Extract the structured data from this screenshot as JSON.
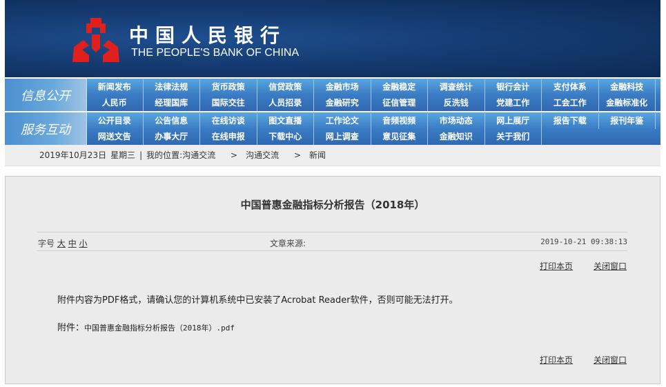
{
  "header": {
    "title_cn": "中国人民银行",
    "title_en": "THE PEOPLE'S BANK OF CHINA"
  },
  "nav": [
    {
      "label": "信息公开",
      "rows": [
        [
          "新闻发布",
          "法律法规",
          "货币政策",
          "信贷政策",
          "金融市场",
          "金融稳定",
          "调查统计",
          "银行会计",
          "支付体系",
          "金融科技"
        ],
        [
          "人民币",
          "经理国库",
          "国际交往",
          "人员招录",
          "金融研究",
          "征信管理",
          "反洗钱",
          "党建工作",
          "工会工作",
          "金融标准化"
        ]
      ]
    },
    {
      "label": "服务互动",
      "rows": [
        [
          "公开目录",
          "公告信息",
          "在线访谈",
          "图文直播",
          "工作论文",
          "音频视频",
          "市场动态",
          "网上展厅",
          "报告下载",
          "报刊年鉴"
        ],
        [
          "网送文告",
          "办事大厅",
          "在线申报",
          "下载中心",
          "网上调查",
          "意见征集",
          "金融知识",
          "关于我们"
        ]
      ]
    }
  ],
  "breadcrumb": {
    "date": "2019年10月23日",
    "weekday": "星期三",
    "sep": "|",
    "location_label": "我的位置:",
    "items": [
      "沟通交流",
      "沟通交流",
      "新闻"
    ],
    "arrow": ">"
  },
  "article": {
    "title": "中国普惠金融指标分析报告（2018年）",
    "font_size_label": "字号",
    "font_sizes": [
      "大",
      "中",
      "小"
    ],
    "source_label": "文章来源:",
    "datetime": "2019-10-21 09:38:13",
    "print_label": "打印本页",
    "close_label": "关闭窗口",
    "notice": "附件内容为PDF格式，请确认您的计算机系统中已安装了Acrobat Reader软件，否则可能无法打开。",
    "attachment_label": "附件：",
    "attachment_file": "中国普惠金融指标分析报告（2018年）.pdf"
  }
}
